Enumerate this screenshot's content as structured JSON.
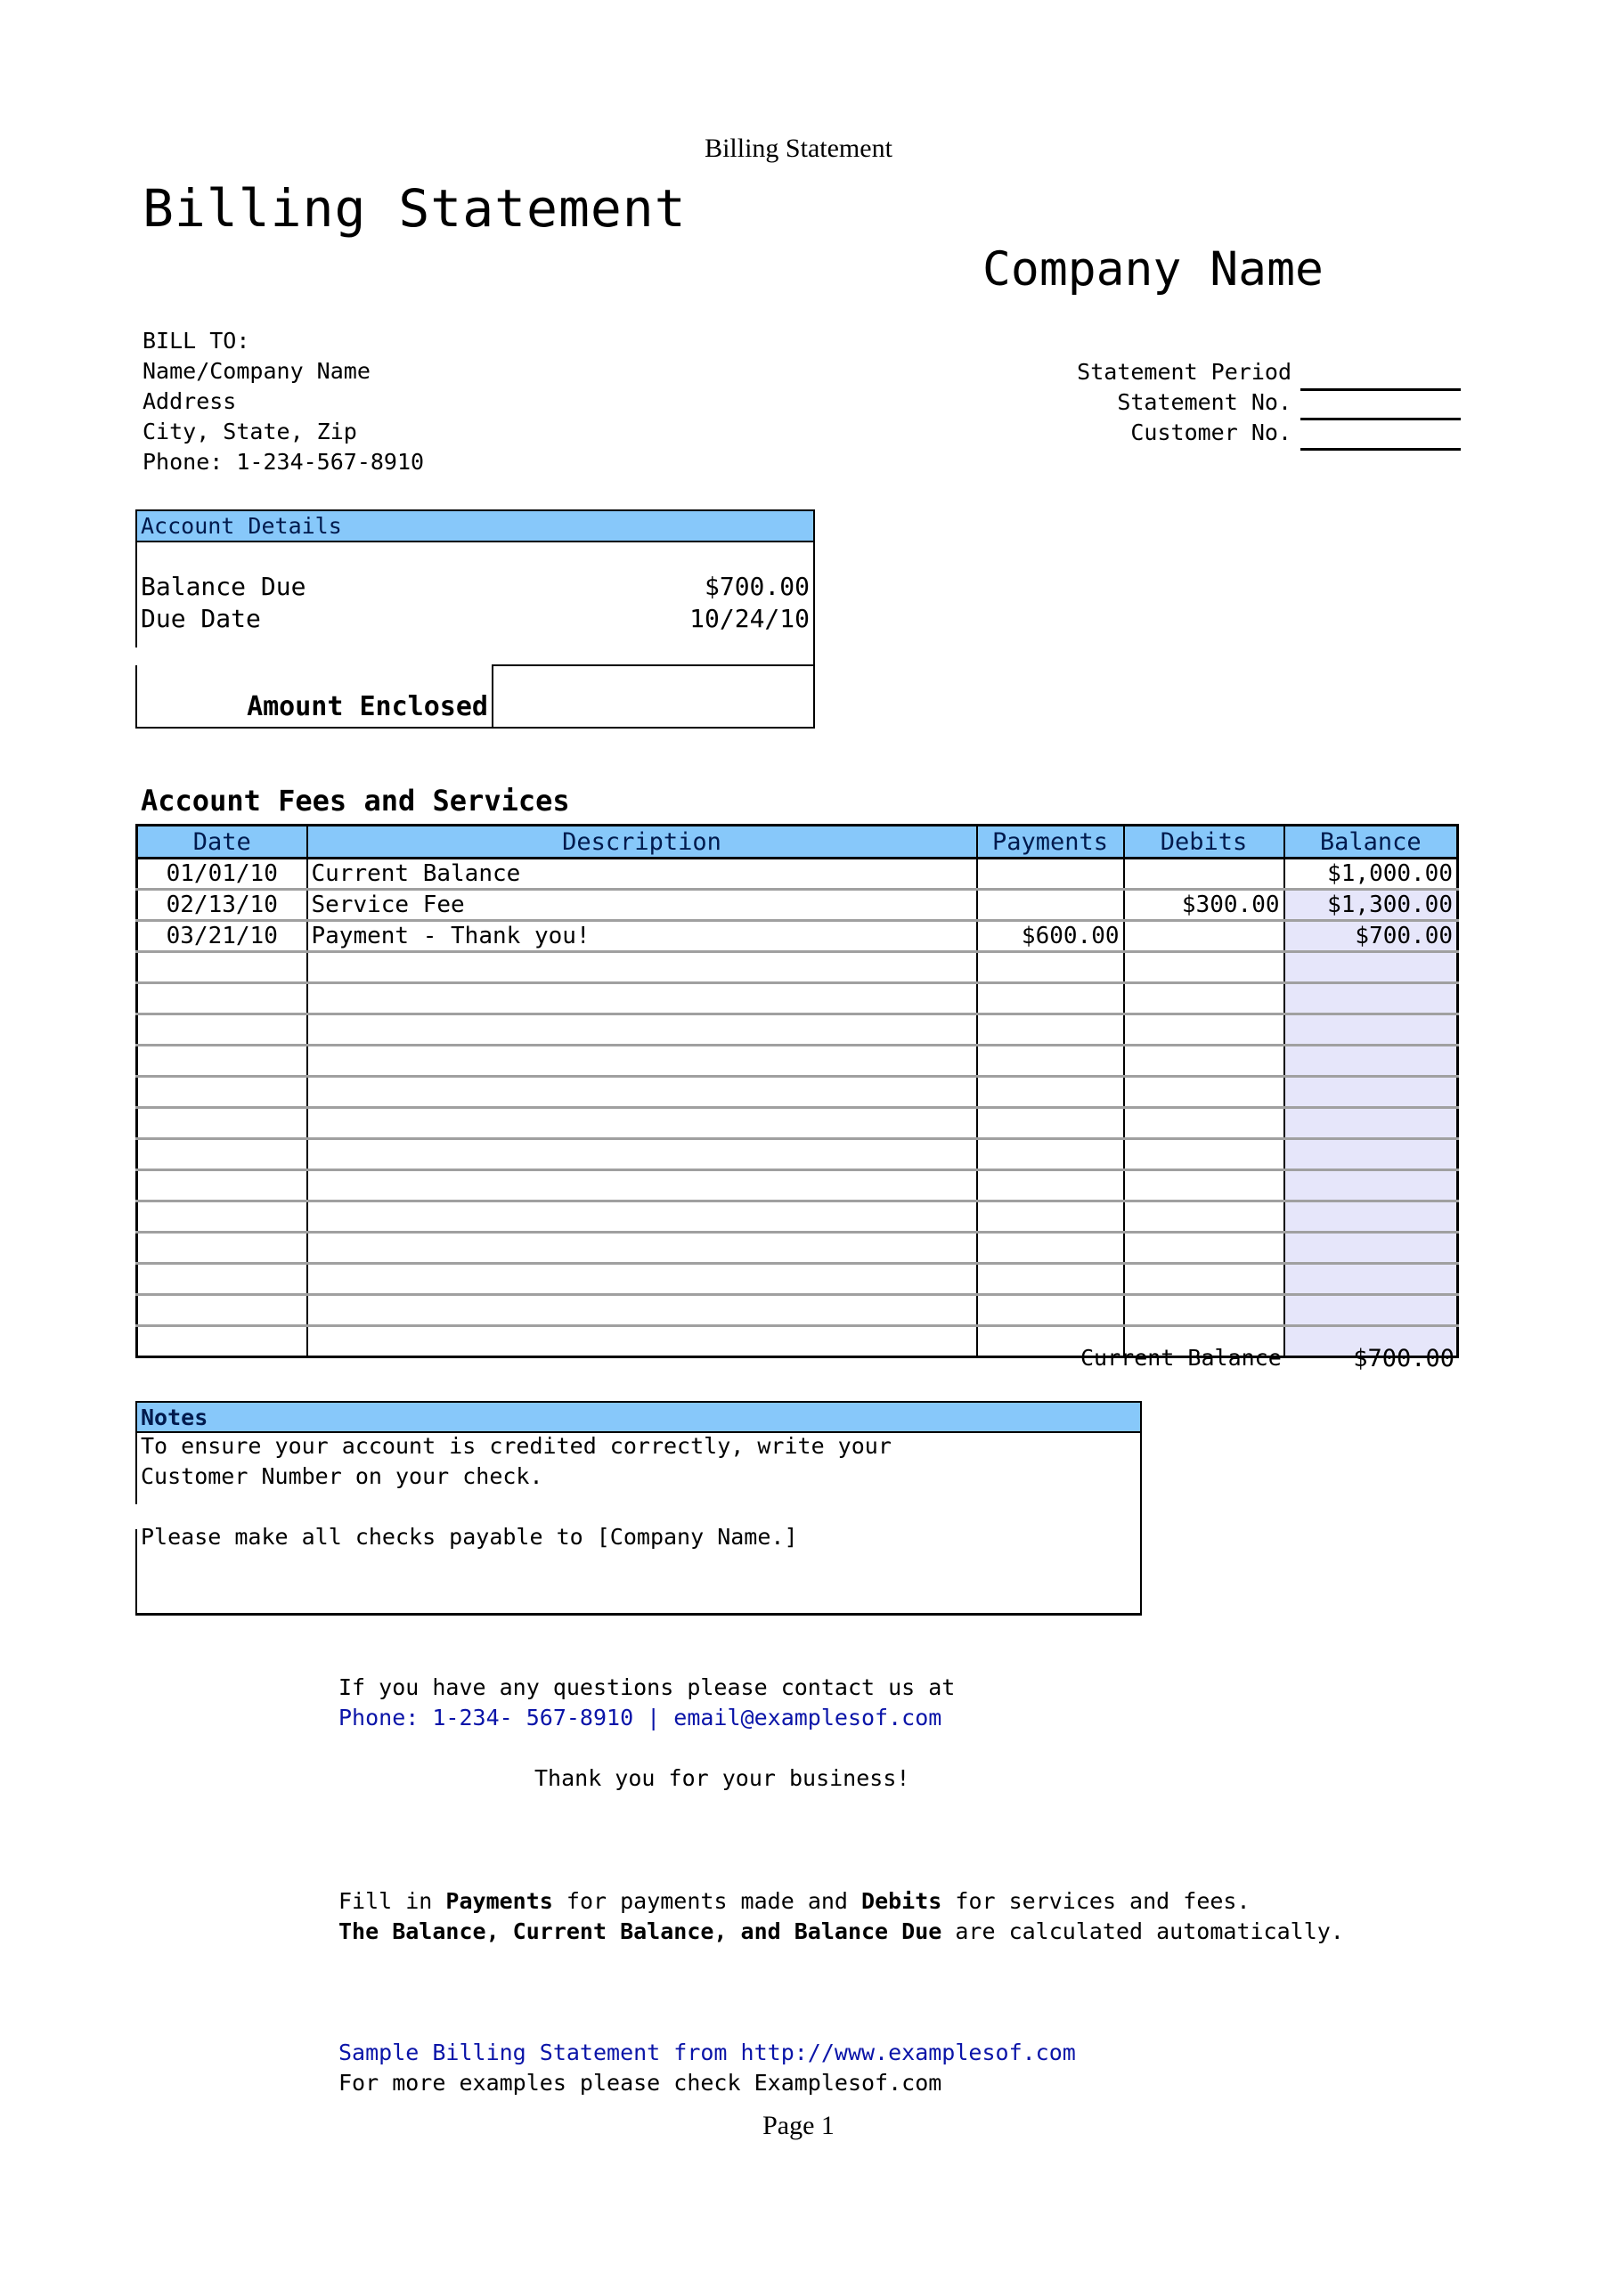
{
  "page_header": "Billing Statement",
  "doc_title": "Billing Statement",
  "company_name": "Company Name",
  "bill_to": {
    "label": "BILL TO:",
    "name": "Name/Company Name",
    "address": "Address",
    "city_state_zip": "City, State, Zip",
    "phone": "Phone: 1-234-567-8910"
  },
  "statement_fields": [
    {
      "label": "Statement Period",
      "value": ""
    },
    {
      "label": "Statement No.",
      "value": ""
    },
    {
      "label": "Customer No.",
      "value": ""
    }
  ],
  "account_details": {
    "header": "Account Details",
    "balance_due_label": "Balance Due",
    "balance_due_value": "$700.00",
    "due_date_label": "Due Date",
    "due_date_value": "10/24/10",
    "amount_enclosed_label": "Amount Enclosed",
    "amount_enclosed_value": ""
  },
  "fees": {
    "title": "Account Fees and Services",
    "columns": [
      "Date",
      "Description",
      "Payments",
      "Debits",
      "Balance"
    ],
    "rows": [
      {
        "date": "01/01/10",
        "description": "Current Balance",
        "payments": "",
        "debits": "",
        "balance": "$1,000.00"
      },
      {
        "date": "02/13/10",
        "description": "Service Fee",
        "payments": "",
        "debits": "$300.00",
        "balance": "$1,300.00"
      },
      {
        "date": "03/21/10",
        "description": "Payment - Thank you!",
        "payments": "$600.00",
        "debits": "",
        "balance": "$700.00"
      },
      {
        "date": "",
        "description": "",
        "payments": "",
        "debits": "",
        "balance": ""
      },
      {
        "date": "",
        "description": "",
        "payments": "",
        "debits": "",
        "balance": ""
      },
      {
        "date": "",
        "description": "",
        "payments": "",
        "debits": "",
        "balance": ""
      },
      {
        "date": "",
        "description": "",
        "payments": "",
        "debits": "",
        "balance": ""
      },
      {
        "date": "",
        "description": "",
        "payments": "",
        "debits": "",
        "balance": ""
      },
      {
        "date": "",
        "description": "",
        "payments": "",
        "debits": "",
        "balance": ""
      },
      {
        "date": "",
        "description": "",
        "payments": "",
        "debits": "",
        "balance": ""
      },
      {
        "date": "",
        "description": "",
        "payments": "",
        "debits": "",
        "balance": ""
      },
      {
        "date": "",
        "description": "",
        "payments": "",
        "debits": "",
        "balance": ""
      },
      {
        "date": "",
        "description": "",
        "payments": "",
        "debits": "",
        "balance": ""
      },
      {
        "date": "",
        "description": "",
        "payments": "",
        "debits": "",
        "balance": ""
      },
      {
        "date": "",
        "description": "",
        "payments": "",
        "debits": "",
        "balance": ""
      },
      {
        "date": "",
        "description": "",
        "payments": "",
        "debits": "",
        "balance": ""
      }
    ],
    "current_balance_label": "Current Balance",
    "current_balance_value": "$700.00"
  },
  "notes": {
    "header": "Notes",
    "lines": [
      "To ensure your account is credited correctly, write your",
      "Customer Number on your check.",
      "",
      "Please make all checks payable to [Company Name.]"
    ]
  },
  "contact": {
    "intro": "If you have any questions please contact us at",
    "details": "Phone: 1-234- 567-8910 | email@examplesof.com",
    "thanks": "Thank you for your business!"
  },
  "instructions": {
    "line1": [
      {
        "text": "Fill in ",
        "bold": false
      },
      {
        "text": "Payments",
        "bold": true
      },
      {
        "text": " for payments made and ",
        "bold": false
      },
      {
        "text": "Debits",
        "bold": true
      },
      {
        "text": " for services and fees.",
        "bold": false
      }
    ],
    "line2": [
      {
        "text": "The Balance, Current Balance, and Balance Due",
        "bold": true
      },
      {
        "text": " are calculated automatically.",
        "bold": false
      }
    ]
  },
  "source": {
    "sample_line": "Sample Billing Statement from http://www.examplesof.com",
    "more_line": "For more examples please check Examplesof.com"
  },
  "page_number": "Page 1",
  "colors": {
    "header_fill": "#87c8fa",
    "balance_fill": "#e6e6fa",
    "link_blue": "#0a14a8"
  }
}
